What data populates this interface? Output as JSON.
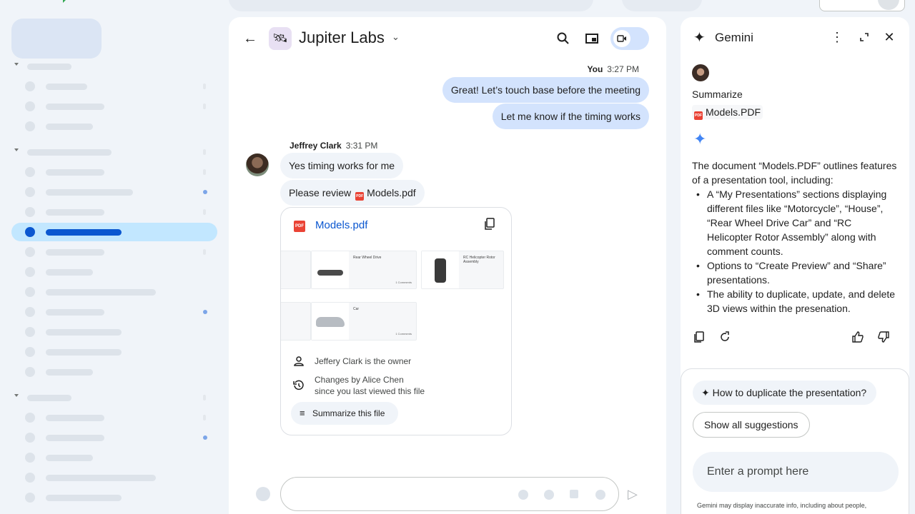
{
  "chat": {
    "space_name": "Jupiter Labs",
    "messages_out": {
      "sender": "You",
      "time": "3:27 PM",
      "items": [
        "Great! Let’s touch base before the meeting",
        "Let me know if the timing works"
      ]
    },
    "messages_in": {
      "sender": "Jeffrey Clark",
      "time": "3:31 PM",
      "text1": "Yes timing works for me",
      "text2_prefix": "Please review",
      "attachment": "Models.pdf"
    },
    "file_card": {
      "pdf_badge": "PDF",
      "title": "Models.pdf",
      "thumbnails": [
        {
          "title": "Rear Wheel Drive",
          "comments": "1 Comments"
        },
        {
          "title": "RC Helicopter Rotor Assembly",
          "comments": ""
        },
        {
          "title": "Car",
          "comments": "1 Comments"
        }
      ],
      "owner_text": "Jeffery Clark is the owner",
      "changes_line1": "Changes by Alice Chen",
      "changes_line2": "since you last viewed this file",
      "summarize_label": "Summarize this file"
    }
  },
  "gemini": {
    "title": "Gemini",
    "request": "Summarize",
    "request_file": "Models.PDF",
    "response_intro": "The document “Models.PDF” outlines features of a presentation tool, including:",
    "response_bullets": [
      "A “My Presentations” sections displaying different files like “Motorcycle”, “House”, “Rear Wheel Drive Car” and “RC Helicopter Rotor Assembly” along with comment counts.",
      "Options to “Create Preview” and “Share” presentations.",
      "The ability to duplicate, update, and delete 3D views within the presenation."
    ],
    "suggestion": "How to duplicate the presentation?",
    "show_all": "Show all suggestions",
    "prompt_placeholder": "Enter a prompt here",
    "disclaimer": "Gemini may display inaccurate info, including about people,"
  },
  "colors": {
    "accent": "#0b57d0",
    "bubble_out": "#d3e3fd",
    "selected_row": "#c2e7ff",
    "pdf_red": "#ea4335"
  },
  "icons": [
    "back-arrow-icon",
    "search-icon",
    "pip-icon",
    "video-call-icon",
    "more-vert-icon",
    "expand-icon",
    "close-icon",
    "copy-icon",
    "refresh-icon",
    "thumbs-up-icon",
    "thumbs-down-icon",
    "person-icon",
    "history-icon",
    "summarize-icon",
    "send-icon",
    "sparkle-icon"
  ]
}
